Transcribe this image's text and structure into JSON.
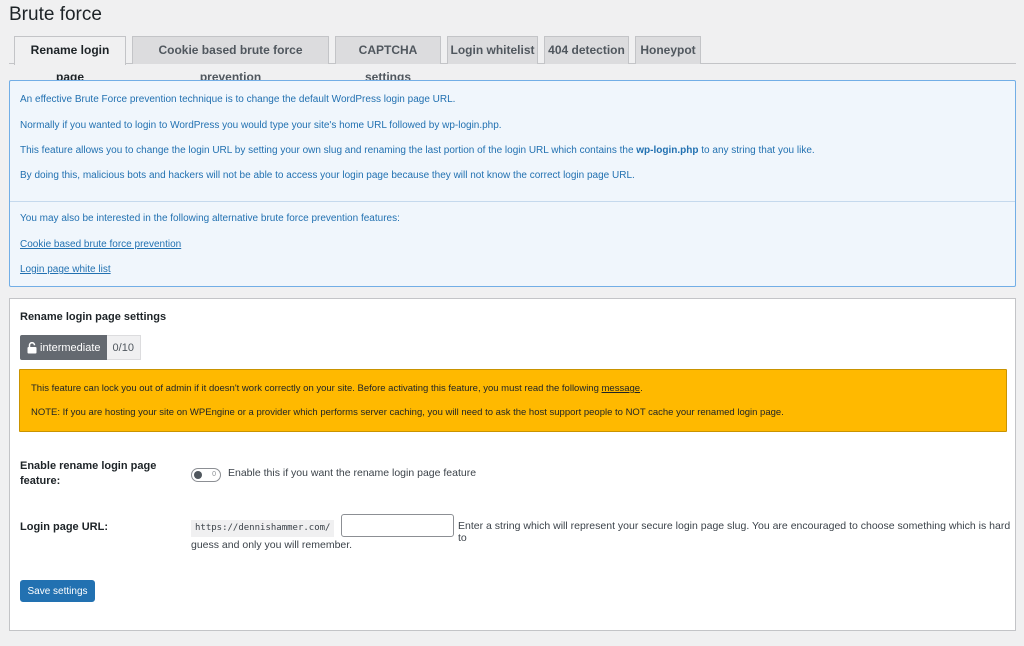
{
  "page": {
    "title": "Brute force"
  },
  "tabs": [
    {
      "label": "Rename login page",
      "active": true
    },
    {
      "label": "Cookie based brute force prevention",
      "active": false
    },
    {
      "label": "CAPTCHA settings",
      "active": false
    },
    {
      "label": "Login whitelist",
      "active": false
    },
    {
      "label": "404 detection",
      "active": false
    },
    {
      "label": "Honeypot",
      "active": false
    }
  ],
  "info": {
    "line1": "An effective Brute Force prevention technique is to change the default WordPress login page URL.",
    "line2": "Normally if you wanted to login to WordPress you would type your site's home URL followed by wp-login.php.",
    "line3_before": "This feature allows you to change the login URL by setting your own slug and renaming the last portion of the login URL which contains the ",
    "line3_bold": "wp-login.php",
    "line3_after": " to any string that you like.",
    "line4": "By doing this, malicious bots and hackers will not be able to access your login page because they will not know the correct login page URL.",
    "alt_intro": "You may also be interested in the following alternative brute force prevention features:",
    "links": [
      "Cookie based brute force prevention",
      "Login page white list"
    ]
  },
  "settings": {
    "title": "Rename login page settings",
    "badge": {
      "level": "intermediate",
      "score": "0/10"
    },
    "warning": {
      "line1_before": "This feature can lock you out of admin if it doesn't work correctly on your site. Before activating this feature, you must read the following ",
      "line1_link": "message",
      "line1_after": ".",
      "line2": "NOTE: If you are hosting your site on WPEngine or a provider which performs server caching, you will need to ask the host support people to NOT cache your renamed login page."
    },
    "enable": {
      "label_line1": "Enable rename login page",
      "label_line2": "feature:",
      "toggle_text": "0",
      "description": "Enable this if you want the rename login page feature"
    },
    "login_url": {
      "label": "Login page URL:",
      "prefix": "https://dennishammer.com/",
      "value": "",
      "description_line1": "Enter a string which will represent your secure login page slug. You are encouraged to choose something which is hard to",
      "description_line2": "guess and only you will remember."
    },
    "save_label": "Save settings"
  },
  "colors": {
    "accent": "#2271b1",
    "info_bg": "#f0f6fc",
    "warning_bg": "#ffb900",
    "badge_bg": "#646970"
  }
}
